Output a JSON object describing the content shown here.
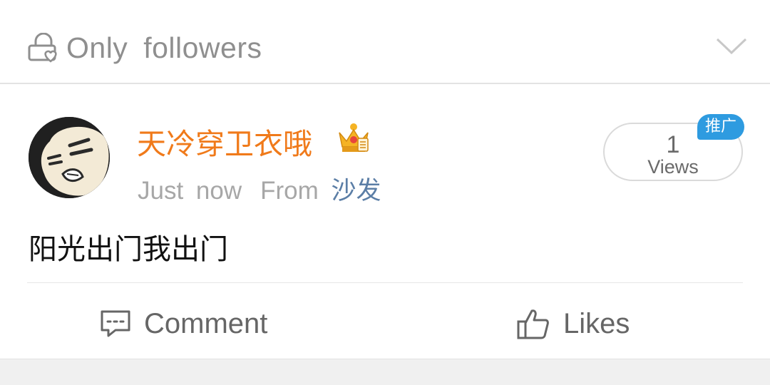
{
  "visibility": {
    "label": "Only  followers",
    "icon": "lock-heart-icon",
    "expand_icon": "chevron-down-icon"
  },
  "post": {
    "author": {
      "name": "天冷穿卫衣哦",
      "badge_icon": "crown-icon",
      "avatar_icon": "cartoon-avatar"
    },
    "time": "Just  now",
    "from_label": "From",
    "source": "沙发",
    "views": {
      "count": "1",
      "label": "Views"
    },
    "promo_badge": "推广",
    "text": "阳光出门我出门"
  },
  "actions": {
    "comment_label": "Comment",
    "comment_icon": "comment-icon",
    "likes_label": "Likes",
    "likes_icon": "thumbs-up-icon"
  },
  "colors": {
    "username": "#f07a1a",
    "source_link": "#5b7ea6",
    "promo_badge": "#2e9be0",
    "muted": "#a7a7a7"
  }
}
